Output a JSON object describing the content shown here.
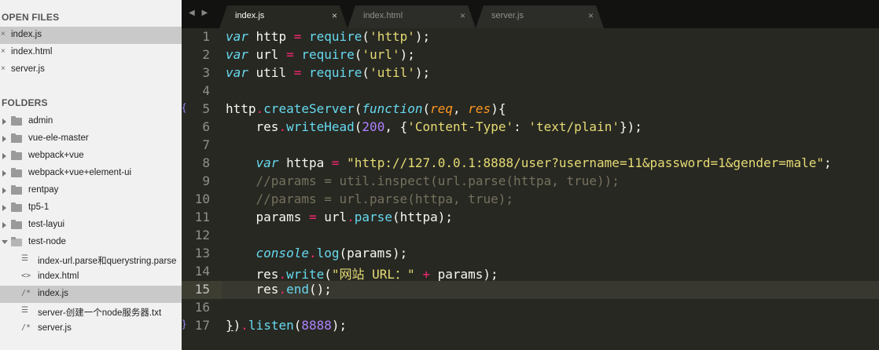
{
  "sidebar": {
    "open_files_heading": "OPEN FILES",
    "open_files": [
      {
        "label": "index.js",
        "close_glyph": "×"
      },
      {
        "label": "index.html",
        "close_glyph": "×"
      },
      {
        "label": "server.js",
        "close_glyph": "×"
      }
    ],
    "folders_heading": "FOLDERS",
    "folders": [
      {
        "label": "admin"
      },
      {
        "label": "vue-ele-master"
      },
      {
        "label": "webpack+vue"
      },
      {
        "label": "webpack+vue+element-ui"
      },
      {
        "label": "rentpay"
      },
      {
        "label": "tp5-1"
      },
      {
        "label": "test-layui"
      },
      {
        "label": "test-node"
      }
    ],
    "files": [
      {
        "label": "index-url.parse和querystring.parse",
        "icon": "text-file-icon",
        "glyph": "☰"
      },
      {
        "label": "index.html",
        "icon": "html-file-icon",
        "glyph": "<>"
      },
      {
        "label": "index.js",
        "icon": "js-file-icon",
        "glyph": "/*"
      },
      {
        "label": "server-创建一个node服务器.txt",
        "icon": "text-file-icon",
        "glyph": "☰"
      },
      {
        "label": "server.js",
        "icon": "js-file-icon",
        "glyph": "/*"
      }
    ]
  },
  "tabbar": {
    "nav_arrows": "◀ ▶",
    "tabs": [
      {
        "label": "index.js",
        "close_glyph": "×",
        "active": true
      },
      {
        "label": "index.html",
        "close_glyph": "×",
        "active": false
      },
      {
        "label": "server.js",
        "close_glyph": "×",
        "active": false
      }
    ]
  },
  "editor": {
    "current_line": 15,
    "fold_markers": [
      "{",
      "}"
    ],
    "lines": [
      {
        "n": "1",
        "tokens": [
          [
            "storage",
            "var"
          ],
          [
            "plain",
            " http "
          ],
          [
            "keyword",
            "="
          ],
          [
            "plain",
            " "
          ],
          [
            "support",
            "require"
          ],
          [
            "plain",
            "("
          ],
          [
            "string",
            "'http'"
          ],
          [
            "plain",
            ");"
          ]
        ]
      },
      {
        "n": "2",
        "tokens": [
          [
            "storage",
            "var"
          ],
          [
            "plain",
            " url "
          ],
          [
            "keyword",
            "="
          ],
          [
            "plain",
            " "
          ],
          [
            "support",
            "require"
          ],
          [
            "plain",
            "("
          ],
          [
            "string",
            "'url'"
          ],
          [
            "plain",
            ");"
          ]
        ]
      },
      {
        "n": "3",
        "tokens": [
          [
            "storage",
            "var"
          ],
          [
            "plain",
            " util "
          ],
          [
            "keyword",
            "="
          ],
          [
            "plain",
            " "
          ],
          [
            "support",
            "require"
          ],
          [
            "plain",
            "("
          ],
          [
            "string",
            "'util'"
          ],
          [
            "plain",
            ");"
          ]
        ]
      },
      {
        "n": "4",
        "tokens": []
      },
      {
        "n": "5",
        "tokens": [
          [
            "plain",
            "http"
          ],
          [
            "keyword",
            "."
          ],
          [
            "support",
            "createServer"
          ],
          [
            "plain",
            "("
          ],
          [
            "storage",
            "function"
          ],
          [
            "plain",
            "("
          ],
          [
            "param",
            "req"
          ],
          [
            "plain",
            ", "
          ],
          [
            "param",
            "res"
          ],
          [
            "plain",
            "){"
          ]
        ]
      },
      {
        "n": "6",
        "tokens": [
          [
            "plain",
            "    res"
          ],
          [
            "keyword",
            "."
          ],
          [
            "support",
            "writeHead"
          ],
          [
            "plain",
            "("
          ],
          [
            "number",
            "200"
          ],
          [
            "plain",
            ", {"
          ],
          [
            "string",
            "'Content-Type'"
          ],
          [
            "plain",
            ": "
          ],
          [
            "string",
            "'text/plain'"
          ],
          [
            "plain",
            "});"
          ]
        ]
      },
      {
        "n": "7",
        "tokens": []
      },
      {
        "n": "8",
        "tokens": [
          [
            "plain",
            "    "
          ],
          [
            "storage",
            "var"
          ],
          [
            "plain",
            " httpa "
          ],
          [
            "keyword",
            "="
          ],
          [
            "plain",
            " "
          ],
          [
            "string",
            "\"http://127.0.0.1:8888/user?username=11&password=1&gender=male\""
          ],
          [
            "plain",
            ";"
          ]
        ]
      },
      {
        "n": "9",
        "tokens": [
          [
            "comment",
            "    //params = util.inspect(url.parse(httpa, true));"
          ]
        ]
      },
      {
        "n": "10",
        "tokens": [
          [
            "comment",
            "    //params = url.parse(httpa, true);"
          ]
        ]
      },
      {
        "n": "11",
        "tokens": [
          [
            "plain",
            "    params "
          ],
          [
            "keyword",
            "="
          ],
          [
            "plain",
            " url"
          ],
          [
            "keyword",
            "."
          ],
          [
            "support",
            "parse"
          ],
          [
            "plain",
            "(httpa);"
          ]
        ]
      },
      {
        "n": "12",
        "tokens": []
      },
      {
        "n": "13",
        "tokens": [
          [
            "plain",
            "    "
          ],
          [
            "storage",
            "console"
          ],
          [
            "keyword",
            "."
          ],
          [
            "support",
            "log"
          ],
          [
            "plain",
            "(params);"
          ]
        ]
      },
      {
        "n": "14",
        "tokens": [
          [
            "plain",
            "    res"
          ],
          [
            "keyword",
            "."
          ],
          [
            "support",
            "write"
          ],
          [
            "plain",
            "("
          ],
          [
            "string",
            "\"网站 URL：\""
          ],
          [
            "plain",
            " "
          ],
          [
            "keyword",
            "+"
          ],
          [
            "plain",
            " params);"
          ]
        ]
      },
      {
        "n": "15",
        "tokens": [
          [
            "plain",
            "    res"
          ],
          [
            "keyword",
            "."
          ],
          [
            "support",
            "end"
          ],
          [
            "plain",
            "();"
          ]
        ]
      },
      {
        "n": "16",
        "tokens": []
      },
      {
        "n": "17",
        "tokens": [
          [
            "match",
            "}"
          ],
          [
            "plain",
            ")"
          ],
          [
            "keyword",
            "."
          ],
          [
            "support",
            "listen"
          ],
          [
            "plain",
            "("
          ],
          [
            "number",
            "8888"
          ],
          [
            "plain",
            ");"
          ]
        ]
      }
    ]
  },
  "colors": {
    "editor_bg": "#272822",
    "sidebar_bg": "#f1f1f1",
    "keyword": "#f92672",
    "storage": "#66d9ef",
    "string": "#e6db74",
    "number": "#ae81ff",
    "param": "#fd971f",
    "comment": "#75715e"
  }
}
